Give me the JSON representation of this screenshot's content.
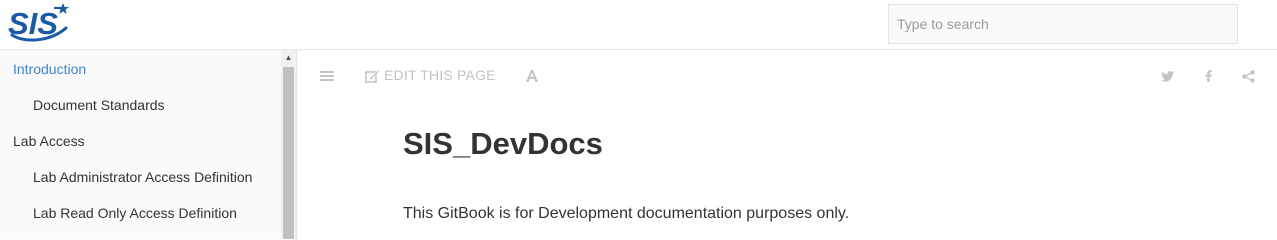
{
  "header": {
    "logo_text": "SIS",
    "search": {
      "placeholder": "Type to search",
      "value": ""
    }
  },
  "sidebar": {
    "items": [
      {
        "label": "Introduction",
        "level": 0,
        "active": true
      },
      {
        "label": "Document Standards",
        "level": 1,
        "active": false
      },
      {
        "label": "Lab Access",
        "level": 0,
        "active": false
      },
      {
        "label": "Lab Administrator Access Definition",
        "level": 1,
        "active": false
      },
      {
        "label": "Lab Read Only Access Definition",
        "level": 1,
        "active": false
      }
    ]
  },
  "toolbar": {
    "toggle_sidebar_icon": "bars-icon",
    "edit_label": "EDIT THIS PAGE",
    "edit_icon": "pencil-square-icon",
    "font_settings_icon": "font-icon",
    "share_icons": [
      "twitter-icon",
      "facebook-icon",
      "share-icon"
    ]
  },
  "page": {
    "title": "SIS_DevDocs",
    "body": "This GitBook is for Development documentation purposes only."
  },
  "colors": {
    "link_active": "#4183c4",
    "text": "#333333",
    "toolbar_icon": "#c4c4c4",
    "logo_blue": "#1a5ba8",
    "sidebar_bg": "#fafafa"
  }
}
